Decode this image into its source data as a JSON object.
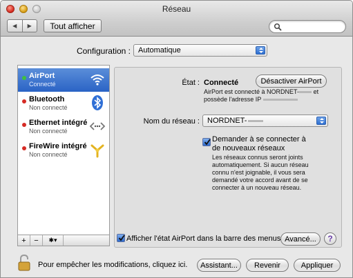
{
  "window": {
    "title": "Réseau"
  },
  "toolbar": {
    "back_label": "◀",
    "forward_label": "▶",
    "show_all_label": "Tout afficher"
  },
  "configuration": {
    "label": "Configuration :",
    "value": "Automatique"
  },
  "services": [
    {
      "name": "AirPort",
      "status": "Connecté",
      "dot_color": "#3fbf3f",
      "icon": "wifi-icon"
    },
    {
      "name": "Bluetooth",
      "status": "Non connecté",
      "dot_color": "#d62b25",
      "icon": "bluetooth-icon"
    },
    {
      "name": "Ethernet intégré",
      "status": "Non connecté",
      "dot_color": "#d62b25",
      "icon": "ethernet-icon"
    },
    {
      "name": "FireWire intégré",
      "status": "Non connecté",
      "dot_color": "#d62b25",
      "icon": "firewire-icon"
    }
  ],
  "sidebar_controls": {
    "add": "+",
    "remove": "−",
    "action": "✱▾"
  },
  "detail": {
    "state_label": "État :",
    "state_value": "Connecté",
    "toggle_button": "Désactiver AirPort",
    "info_line1_prefix": "AirPort est connecté à NORDNET-",
    "info_line1_suffix": "et",
    "info_line2": "possède l'adresse IP",
    "network_label": "Nom du réseau :",
    "network_value": "NORDNET-",
    "ask_checkbox_label": "Demander à se connecter à de nouveaux réseaux",
    "ask_help_text": "Les réseaux connus seront joints automatiquement. Si aucun réseau connu n'est joignable, il vous sera demandé votre accord avant de se connecter à un nouveau réseau.",
    "show_in_menu_label": "Afficher l'état AirPort dans la barre des menus",
    "advanced_button": "Avancé...",
    "help_button": "?"
  },
  "footer": {
    "lock_text": "Pour empêcher les modifications, cliquez ici.",
    "assistant_button": "Assistant...",
    "revert_button": "Revenir",
    "apply_button": "Appliquer"
  }
}
